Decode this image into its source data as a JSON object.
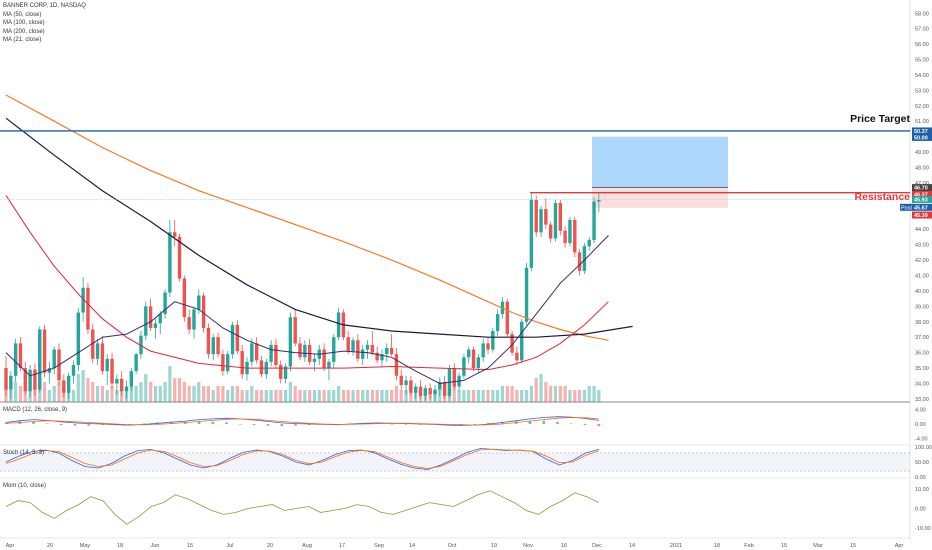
{
  "legend": {
    "symbol": "BANNER CORP, 1D, NASDAQ",
    "ma1": "MA (50, close)",
    "ma2": "MA (100, close)",
    "ma3": "MA (200, close)",
    "ma4": "MA (21, close)"
  },
  "panes": {
    "macd_label": "MACD (12, 26, close, 9)",
    "stoch_label": "Stoch (14, 3, 3)",
    "mom_label": "Mom (10, close)"
  },
  "annotations": {
    "price_target": "Price Target",
    "resistance": "Resistance"
  },
  "colors": {
    "up": "#26a69a",
    "down": "#ef5350",
    "ma50": "#1a1a40",
    "ma100": "#e0283a",
    "ma200": "#f07c2a",
    "ma21": "#3b2a6e",
    "target_line": "#1f5fa8",
    "resistance_line": "#e0383e"
  },
  "chart_data": {
    "type": "candlestick",
    "price_axis": {
      "ticks": [
        "58.00",
        "57.00",
        "56.00",
        "55.00",
        "54.00",
        "53.00",
        "52.00",
        "51.00",
        "50.00",
        "49.00",
        "48.00",
        "47.00",
        "46.00",
        "45.00",
        "44.00",
        "43.00",
        "42.00",
        "41.00",
        "40.00",
        "39.00",
        "38.00",
        "37.00",
        "36.00",
        "35.00",
        "34.00",
        "33.00"
      ],
      "range": [
        32.8,
        58.6
      ]
    },
    "price_labels": {
      "target_1": "50.37",
      "target_2": "50.00",
      "box_top": "46.70",
      "resistance": "46.37",
      "last_close": "45.93",
      "post": "Post",
      "post_value": "45.67",
      "box_bottom": "45.39"
    },
    "macd_axis": [
      "4.00",
      "0.00",
      "-4.00"
    ],
    "stoch_axis": [
      "100.00",
      "50.00",
      "0.00"
    ],
    "mom_axis": [
      "10.00",
      "0.00",
      "-10.00"
    ],
    "x_labels": [
      "Apr",
      "20",
      "May",
      "18",
      "Jun",
      "15",
      "Jul",
      "20",
      "Aug",
      "17",
      "Sep",
      "14",
      "Oct",
      "19",
      "Nov",
      "16",
      "Dec",
      "14",
      "2021",
      "18",
      "Feb",
      "15",
      "Mar",
      "15",
      "Apr"
    ],
    "levels": {
      "price_target": 50.37,
      "resistance": 46.37,
      "box_top": 46.7,
      "box_bottom": 45.39,
      "target_zone_top": 50.0
    },
    "candles": [
      [
        35.0,
        35.8,
        33.2,
        33.6
      ],
      [
        33.6,
        34.8,
        33.0,
        34.5
      ],
      [
        34.5,
        36.9,
        34.1,
        36.6
      ],
      [
        36.6,
        37.0,
        34.8,
        35.0
      ],
      [
        35.0,
        35.4,
        33.3,
        33.5
      ],
      [
        33.5,
        35.2,
        33.1,
        34.9
      ],
      [
        34.9,
        35.3,
        33.2,
        33.6
      ],
      [
        33.6,
        37.7,
        33.4,
        37.5
      ],
      [
        37.5,
        37.8,
        34.4,
        34.7
      ],
      [
        34.7,
        35.4,
        34.0,
        35.0
      ],
      [
        35.0,
        36.4,
        34.6,
        36.2
      ],
      [
        36.2,
        36.6,
        33.9,
        34.2
      ],
      [
        34.2,
        34.6,
        33.1,
        33.4
      ],
      [
        33.4,
        34.7,
        33.0,
        34.5
      ],
      [
        34.5,
        35.5,
        34.0,
        35.2
      ],
      [
        35.2,
        38.9,
        34.8,
        38.6
      ],
      [
        38.6,
        40.9,
        38.0,
        40.2
      ],
      [
        40.2,
        40.5,
        37.2,
        37.5
      ],
      [
        37.5,
        37.9,
        35.3,
        35.6
      ],
      [
        35.6,
        36.9,
        35.2,
        36.6
      ],
      [
        36.6,
        37.1,
        34.6,
        34.8
      ],
      [
        34.8,
        35.9,
        33.9,
        35.6
      ],
      [
        35.6,
        36.0,
        33.7,
        34.0
      ],
      [
        34.0,
        34.6,
        33.3,
        34.3
      ],
      [
        34.3,
        34.8,
        33.2,
        33.5
      ],
      [
        33.5,
        34.2,
        33.0,
        33.8
      ],
      [
        33.8,
        35.0,
        33.5,
        34.8
      ],
      [
        34.8,
        36.0,
        34.6,
        35.9
      ],
      [
        35.9,
        37.4,
        35.6,
        37.1
      ],
      [
        37.1,
        39.3,
        36.8,
        39.0
      ],
      [
        39.0,
        39.5,
        37.4,
        37.6
      ],
      [
        37.6,
        38.2,
        36.9,
        37.9
      ],
      [
        37.9,
        38.7,
        37.2,
        38.5
      ],
      [
        38.5,
        40.1,
        38.2,
        39.9
      ],
      [
        39.9,
        44.6,
        39.6,
        43.8
      ],
      [
        43.8,
        44.6,
        42.9,
        43.5
      ],
      [
        43.5,
        43.7,
        40.6,
        40.8
      ],
      [
        40.8,
        41.0,
        38.0,
        38.3
      ],
      [
        38.3,
        38.8,
        37.2,
        37.5
      ],
      [
        37.5,
        39.0,
        36.9,
        38.8
      ],
      [
        38.8,
        40.1,
        38.5,
        39.7
      ],
      [
        39.7,
        39.9,
        37.3,
        37.6
      ],
      [
        37.6,
        37.9,
        35.6,
        35.9
      ],
      [
        35.9,
        37.2,
        35.5,
        37.0
      ],
      [
        37.0,
        37.3,
        35.7,
        35.9
      ],
      [
        35.9,
        36.2,
        34.5,
        34.8
      ],
      [
        34.8,
        36.1,
        34.6,
        35.9
      ],
      [
        35.9,
        38.0,
        35.6,
        37.8
      ],
      [
        37.8,
        38.1,
        35.9,
        36.1
      ],
      [
        36.1,
        36.5,
        34.3,
        34.6
      ],
      [
        34.6,
        35.7,
        34.2,
        35.4
      ],
      [
        35.4,
        36.9,
        35.1,
        36.6
      ],
      [
        36.6,
        37.0,
        35.3,
        35.5
      ],
      [
        35.5,
        35.8,
        34.4,
        34.6
      ],
      [
        34.6,
        35.6,
        34.3,
        35.4
      ],
      [
        35.4,
        36.8,
        35.1,
        36.5
      ],
      [
        36.5,
        36.9,
        35.0,
        35.2
      ],
      [
        35.2,
        35.5,
        34.0,
        34.3
      ],
      [
        34.3,
        35.3,
        34.0,
        35.1
      ],
      [
        35.1,
        38.6,
        34.8,
        38.3
      ],
      [
        38.3,
        38.8,
        36.4,
        36.6
      ],
      [
        36.6,
        37.0,
        35.5,
        35.7
      ],
      [
        35.7,
        36.8,
        35.4,
        36.5
      ],
      [
        36.5,
        36.9,
        35.2,
        35.4
      ],
      [
        35.4,
        35.9,
        34.8,
        35.6
      ],
      [
        35.6,
        36.5,
        35.2,
        36.2
      ],
      [
        36.2,
        36.6,
        34.8,
        35.0
      ],
      [
        35.0,
        35.6,
        34.2,
        35.4
      ],
      [
        35.4,
        37.2,
        35.0,
        37.0
      ],
      [
        37.0,
        38.9,
        36.8,
        38.6
      ],
      [
        38.6,
        38.8,
        36.8,
        37.0
      ],
      [
        37.0,
        37.4,
        35.9,
        36.1
      ],
      [
        36.1,
        37.0,
        35.8,
        36.8
      ],
      [
        36.8,
        37.2,
        35.4,
        35.6
      ],
      [
        35.6,
        36.5,
        35.2,
        36.2
      ],
      [
        36.2,
        36.8,
        35.6,
        36.5
      ],
      [
        36.5,
        37.4,
        35.8,
        36.0
      ],
      [
        36.0,
        36.4,
        35.3,
        35.5
      ],
      [
        35.5,
        36.2,
        35.1,
        35.9
      ],
      [
        35.9,
        36.6,
        35.4,
        36.3
      ],
      [
        36.3,
        37.2,
        35.8,
        35.9
      ],
      [
        35.9,
        36.3,
        34.2,
        34.5
      ],
      [
        34.5,
        34.9,
        33.6,
        33.9
      ],
      [
        33.9,
        34.5,
        33.3,
        34.2
      ],
      [
        34.2,
        34.5,
        33.2,
        33.4
      ],
      [
        33.4,
        34.0,
        33.0,
        33.8
      ],
      [
        33.8,
        34.2,
        33.0,
        33.2
      ],
      [
        33.2,
        33.9,
        32.9,
        33.7
      ],
      [
        33.7,
        34.0,
        33.0,
        33.3
      ],
      [
        33.3,
        33.9,
        32.9,
        33.6
      ],
      [
        33.6,
        34.4,
        33.2,
        34.1
      ],
      [
        34.1,
        34.5,
        33.0,
        33.2
      ],
      [
        33.2,
        35.2,
        33.0,
        35.0
      ],
      [
        35.0,
        35.3,
        33.6,
        33.8
      ],
      [
        33.8,
        34.7,
        33.5,
        34.5
      ],
      [
        34.5,
        35.9,
        34.3,
        35.7
      ],
      [
        35.7,
        36.4,
        35.3,
        36.2
      ],
      [
        36.2,
        36.4,
        34.8,
        35.0
      ],
      [
        35.0,
        35.9,
        34.7,
        35.7
      ],
      [
        35.7,
        36.9,
        35.4,
        36.6
      ],
      [
        36.6,
        37.0,
        35.9,
        36.2
      ],
      [
        36.2,
        37.6,
        36.0,
        37.4
      ],
      [
        37.4,
        38.8,
        37.1,
        38.5
      ],
      [
        38.5,
        39.6,
        38.2,
        39.3
      ],
      [
        39.3,
        39.5,
        37.0,
        37.2
      ],
      [
        37.2,
        37.4,
        35.8,
        36.0
      ],
      [
        36.0,
        36.4,
        35.2,
        35.5
      ],
      [
        35.5,
        38.2,
        35.3,
        38.0
      ],
      [
        38.0,
        41.8,
        37.8,
        41.5
      ],
      [
        41.5,
        46.3,
        41.3,
        45.9
      ],
      [
        45.9,
        46.2,
        43.5,
        43.8
      ],
      [
        43.8,
        45.5,
        43.5,
        45.3
      ],
      [
        45.3,
        46.0,
        44.0,
        44.3
      ],
      [
        44.3,
        44.5,
        43.1,
        43.4
      ],
      [
        43.4,
        45.9,
        43.2,
        45.7
      ],
      [
        45.7,
        45.9,
        43.6,
        43.9
      ],
      [
        43.9,
        44.2,
        42.8,
        43.1
      ],
      [
        43.1,
        44.8,
        42.9,
        44.6
      ],
      [
        44.6,
        44.8,
        42.2,
        42.5
      ],
      [
        42.5,
        42.7,
        41.0,
        41.3
      ],
      [
        41.3,
        43.1,
        41.1,
        42.9
      ],
      [
        42.9,
        43.5,
        42.6,
        43.3
      ],
      [
        43.3,
        46.1,
        43.1,
        45.8
      ],
      [
        45.8,
        46.4,
        45.1,
        45.9
      ]
    ],
    "volume_scale": [
      0,
      10
    ],
    "volumes": [
      4,
      3,
      5,
      4,
      4,
      3,
      4,
      6,
      5,
      3,
      4,
      5,
      4,
      3,
      3,
      7,
      8,
      6,
      5,
      4,
      4,
      3,
      4,
      3,
      3,
      3,
      4,
      4,
      5,
      7,
      5,
      4,
      4,
      5,
      9,
      6,
      6,
      5,
      4,
      4,
      5,
      4,
      4,
      3,
      4,
      4,
      3,
      4,
      4,
      3,
      3,
      4,
      3,
      3,
      3,
      3,
      3,
      3,
      3,
      5,
      4,
      3,
      3,
      3,
      3,
      3,
      3,
      3,
      3,
      4,
      3,
      3,
      3,
      3,
      3,
      3,
      3,
      3,
      3,
      3,
      3,
      4,
      3,
      3,
      3,
      3,
      3,
      3,
      3,
      3,
      3,
      3,
      3,
      4,
      3,
      3,
      3,
      3,
      3,
      3,
      3,
      3,
      3,
      4,
      4,
      4,
      3,
      3,
      3,
      4,
      6,
      7,
      5,
      4,
      4,
      4,
      4,
      3,
      3,
      3,
      3,
      4,
      4,
      3,
      4,
      3
    ],
    "ma50": [
      [
        0,
        51.2
      ],
      [
        10,
        48.8
      ],
      [
        20,
        46.5
      ],
      [
        30,
        44.5
      ],
      [
        40,
        42.3
      ],
      [
        50,
        40.4
      ],
      [
        60,
        38.8
      ],
      [
        70,
        37.8
      ],
      [
        80,
        37.4
      ],
      [
        90,
        37.2
      ],
      [
        100,
        37.0
      ],
      [
        110,
        37.0
      ],
      [
        120,
        37.2
      ],
      [
        130,
        37.7
      ]
    ],
    "ma100": [
      [
        0,
        46.2
      ],
      [
        5,
        43.8
      ],
      [
        10,
        41.6
      ],
      [
        15,
        39.8
      ],
      [
        20,
        38.2
      ],
      [
        25,
        37.0
      ],
      [
        30,
        36.1
      ],
      [
        40,
        35.3
      ],
      [
        50,
        35.0
      ],
      [
        60,
        35.0
      ],
      [
        70,
        35.0
      ],
      [
        80,
        35.1
      ],
      [
        90,
        35.0
      ],
      [
        100,
        34.9
      ],
      [
        105,
        35.2
      ],
      [
        110,
        35.7
      ],
      [
        115,
        36.6
      ],
      [
        120,
        37.8
      ],
      [
        125,
        39.3
      ]
    ],
    "ma200": [
      [
        0,
        52.7
      ],
      [
        10,
        51.0
      ],
      [
        20,
        49.3
      ],
      [
        30,
        47.8
      ],
      [
        40,
        46.5
      ],
      [
        50,
        45.4
      ],
      [
        60,
        44.3
      ],
      [
        70,
        43.2
      ],
      [
        80,
        42.0
      ],
      [
        90,
        40.7
      ],
      [
        100,
        39.3
      ],
      [
        105,
        38.6
      ],
      [
        110,
        38.0
      ],
      [
        115,
        37.5
      ],
      [
        120,
        37.1
      ],
      [
        125,
        36.8
      ]
    ],
    "ma21": [
      [
        0,
        36.0
      ],
      [
        5,
        34.5
      ],
      [
        10,
        35.0
      ],
      [
        15,
        36.0
      ],
      [
        20,
        37.0
      ],
      [
        25,
        37.2
      ],
      [
        30,
        38.0
      ],
      [
        35,
        39.3
      ],
      [
        40,
        38.8
      ],
      [
        45,
        37.6
      ],
      [
        50,
        36.8
      ],
      [
        55,
        36.2
      ],
      [
        60,
        36.0
      ],
      [
        65,
        35.9
      ],
      [
        70,
        36.1
      ],
      [
        75,
        36.0
      ],
      [
        80,
        35.7
      ],
      [
        85,
        34.8
      ],
      [
        90,
        34.0
      ],
      [
        95,
        34.2
      ],
      [
        100,
        35.0
      ],
      [
        105,
        36.5
      ],
      [
        110,
        38.5
      ],
      [
        115,
        40.5
      ],
      [
        120,
        42.0
      ],
      [
        125,
        43.6
      ]
    ],
    "macd": [
      0.4,
      0.9,
      1.2,
      1.0,
      0.6,
      0.3,
      0.1,
      0.0,
      -0.2,
      -0.3,
      -0.1,
      0.2,
      0.5,
      0.8,
      1.2,
      1.4,
      1.6,
      1.4,
      1.1,
      0.7,
      0.3,
      0.1,
      0.0,
      -0.1,
      -0.2,
      0.0,
      0.2,
      0.3,
      0.2,
      0.1,
      0.0,
      -0.1,
      -0.3,
      -0.4,
      -0.3,
      0.0,
      0.4,
      0.9,
      1.4,
      1.8,
      2.0,
      1.9,
      1.5,
      1.0
    ],
    "macd_signal": [
      0.2,
      0.4,
      0.7,
      0.9,
      0.8,
      0.6,
      0.4,
      0.2,
      0.0,
      -0.2,
      -0.2,
      -0.1,
      0.1,
      0.4,
      0.7,
      1.0,
      1.3,
      1.4,
      1.3,
      1.0,
      0.7,
      0.4,
      0.2,
      0.0,
      -0.1,
      -0.1,
      0.0,
      0.1,
      0.2,
      0.2,
      0.1,
      0.0,
      -0.1,
      -0.2,
      -0.3,
      -0.2,
      0.0,
      0.4,
      0.8,
      1.2,
      1.6,
      1.8,
      1.7,
      1.4
    ],
    "stoch_k": [
      50,
      70,
      85,
      90,
      80,
      55,
      35,
      30,
      45,
      70,
      88,
      92,
      80,
      60,
      40,
      30,
      40,
      62,
      82,
      90,
      85,
      70,
      50,
      40,
      55,
      75,
      88,
      90,
      80,
      60,
      42,
      30,
      25,
      40,
      60,
      82,
      95,
      92,
      88,
      90,
      85,
      60,
      40,
      55,
      80,
      92
    ],
    "stoch_d": [
      45,
      60,
      78,
      88,
      85,
      65,
      45,
      35,
      40,
      60,
      80,
      90,
      85,
      68,
      48,
      35,
      38,
      55,
      75,
      87,
      86,
      75,
      56,
      44,
      50,
      68,
      83,
      89,
      84,
      66,
      48,
      35,
      28,
      36,
      55,
      75,
      90,
      93,
      90,
      89,
      86,
      70,
      48,
      50,
      72,
      88
    ],
    "momentum": [
      1,
      4,
      3,
      -2,
      -5,
      -1,
      2,
      6,
      4,
      -3,
      -8,
      -4,
      1,
      3,
      7,
      5,
      2,
      -1,
      -3,
      -2,
      0,
      1,
      2,
      -1,
      0,
      1,
      -2,
      -1,
      0,
      2,
      1,
      -2,
      -3,
      -1,
      1,
      3,
      2,
      1,
      4,
      7,
      9,
      6,
      3,
      -1,
      -3,
      1,
      4,
      8,
      6,
      3
    ]
  }
}
